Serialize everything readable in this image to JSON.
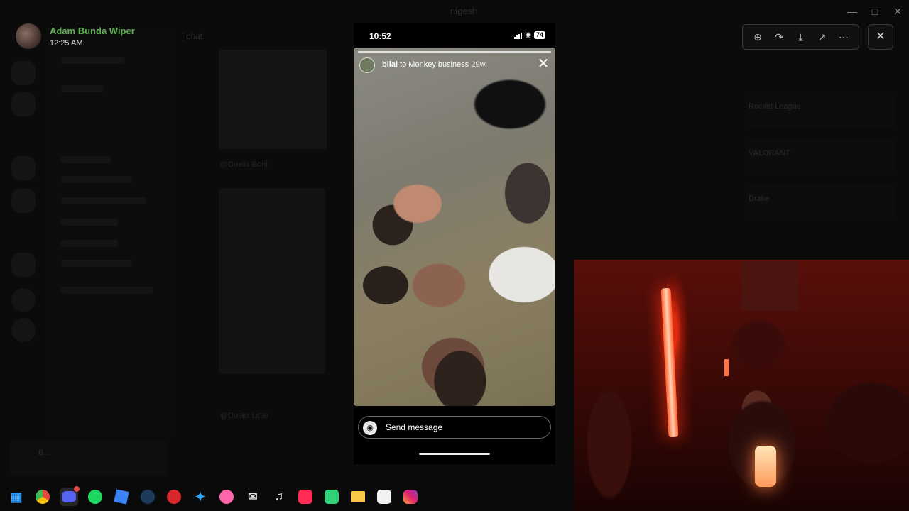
{
  "background_window": {
    "title": "nigesh",
    "chat_channel": "| chat",
    "user_panel": "B...",
    "channel_caption_1": "@Duelix Boni",
    "channel_caption_2": "@Duelix Little",
    "members": [
      "Rocket League",
      "VALORANT",
      "Drake"
    ]
  },
  "viewer_header": {
    "user_name": "Adam Bunda Wiper",
    "timestamp": "12:25 AM"
  },
  "toolbar": {
    "icons": [
      "zoom-in-icon",
      "forward-icon",
      "download-icon",
      "open-external-icon",
      "more-icon"
    ],
    "close_icon": "close-icon"
  },
  "phone": {
    "status_time": "10:52",
    "battery": "74",
    "story": {
      "username": "bilal",
      "to_text": "to Monkey business",
      "age": "29w"
    },
    "send_placeholder": "Send message"
  },
  "taskbar": {
    "apps": [
      "windows-start",
      "chrome",
      "discord",
      "spotify",
      "roblox-studio",
      "steam",
      "mega",
      "battle-net",
      "osu",
      "gmail",
      "tiktok",
      "tiktok-live",
      "bluestacks",
      "file-explorer",
      "capcut",
      "instagram"
    ]
  },
  "colors": {
    "accent_green": "#5fae53",
    "webcam_red": "#5a0f0a"
  }
}
